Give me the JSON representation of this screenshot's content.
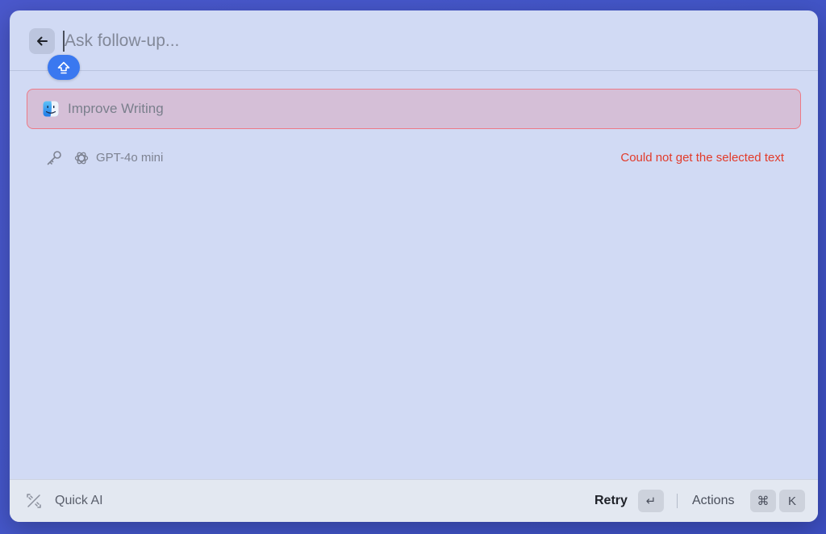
{
  "header": {
    "back_icon": "arrow-left-icon",
    "search_placeholder": "Ask follow-up...",
    "search_value": "",
    "shift_icon": "shift-up-arrow-icon"
  },
  "command": {
    "icon": "finder-icon",
    "label": "Improve Writing",
    "highlight_color": "#ec7a87"
  },
  "meta": {
    "key_icon": "key-icon",
    "model_icon": "openai-icon",
    "model_label": "GPT-4o mini",
    "error_message": "Could not get the selected text",
    "error_color": "#e23b2a"
  },
  "footer": {
    "app_icon": "quick-ai-icon",
    "app_label": "Quick AI",
    "primary_action_label": "Retry",
    "primary_shortcut": "↵",
    "actions_label": "Actions",
    "actions_shortcut_mod": "⌘",
    "actions_shortcut_key": "K"
  },
  "colors": {
    "background": "#4356c8",
    "window": "#d1daf4",
    "accent": "#3a78f0"
  }
}
